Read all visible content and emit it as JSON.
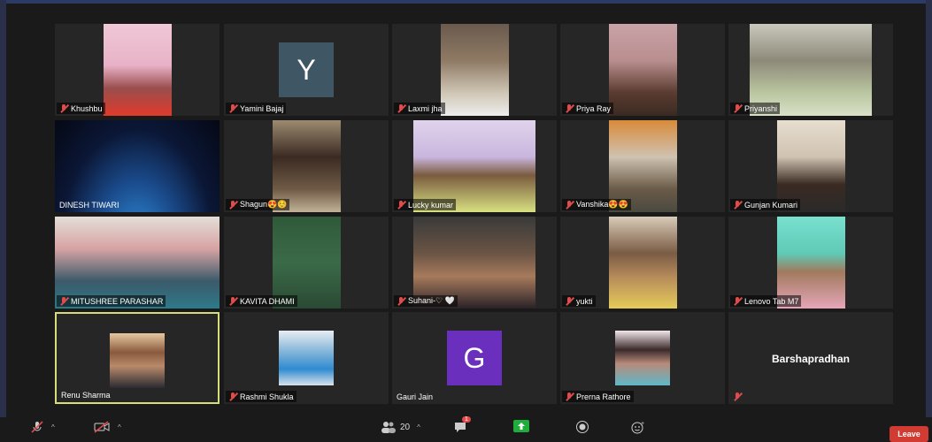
{
  "participants": [
    {
      "name": "Khushbu",
      "muted": true
    },
    {
      "name": "Yamini Bajaj",
      "muted": true,
      "avatar_letter": "Y",
      "avatar_color": "#3f5665"
    },
    {
      "name": "Laxmi jha",
      "muted": true
    },
    {
      "name": "Priya Ray",
      "muted": true
    },
    {
      "name": "Priyanshi",
      "muted": true
    },
    {
      "name": "DINESH TIWARI",
      "muted": false
    },
    {
      "name": "Shagun😍☺️",
      "muted": true
    },
    {
      "name": "Lucky kumar",
      "muted": true
    },
    {
      "name": "Vanshika😍😍",
      "muted": true
    },
    {
      "name": "Gunjan Kumari",
      "muted": true
    },
    {
      "name": "MITUSHREE PARASHAR",
      "muted": true
    },
    {
      "name": "KAVITA DHAMI",
      "muted": true
    },
    {
      "name": "Suhani-♡ 🤍",
      "muted": true
    },
    {
      "name": "yukti",
      "muted": true
    },
    {
      "name": "Lenovo Tab M7",
      "muted": true
    },
    {
      "name": "Renu Sharma",
      "muted": false,
      "active_speaker": true
    },
    {
      "name": "Rashmi Shukla",
      "muted": true
    },
    {
      "name": "Gauri Jain",
      "muted": false,
      "avatar_letter": "G",
      "avatar_color": "#6a2fbd"
    },
    {
      "name": "Prerna Rathore",
      "muted": true
    },
    {
      "name": "",
      "muted": true,
      "display_name": "Barshapradhan"
    }
  ],
  "toolbar": {
    "participants_count": "20",
    "chat_badge": "1",
    "leave_label": "Leave"
  },
  "colors": {
    "active_border": "#d6dd7a",
    "leave": "#d23b32",
    "share": "#1fae3c"
  }
}
